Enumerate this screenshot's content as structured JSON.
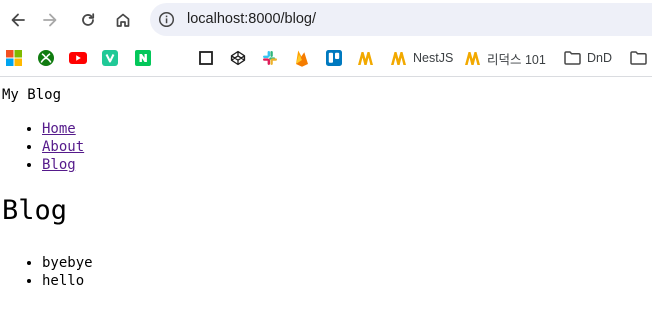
{
  "browser": {
    "url": "localhost:8000/blog/",
    "bookmarks": [
      {
        "icon": "windows-logo-icon",
        "label": ""
      },
      {
        "icon": "xbox-icon",
        "label": ""
      },
      {
        "icon": "youtube-icon",
        "label": ""
      },
      {
        "icon": "v-app-icon",
        "label": ""
      },
      {
        "icon": "naver-icon",
        "label": ""
      },
      {
        "icon": "square-icon",
        "label": ""
      },
      {
        "icon": "codepen-icon",
        "label": ""
      },
      {
        "icon": "slack-icon",
        "label": ""
      },
      {
        "icon": "firebase-icon",
        "label": ""
      },
      {
        "icon": "trello-icon",
        "label": ""
      },
      {
        "icon": "m-logo-icon",
        "label": ""
      },
      {
        "icon": "m-logo-icon",
        "label": "NestJS"
      },
      {
        "icon": "m-logo-icon",
        "label": "리덕스 101"
      },
      {
        "icon": "folder-icon",
        "label": "DnD"
      },
      {
        "icon": "folder-icon",
        "label": ""
      }
    ]
  },
  "page": {
    "site_title": "My Blog",
    "nav": [
      "Home",
      "About",
      "Blog"
    ],
    "heading": "Blog",
    "posts": [
      "byebye",
      "hello"
    ]
  },
  "colors": {
    "link_visited": "#551a8b",
    "omnibox_bg": "#eef0f8"
  }
}
